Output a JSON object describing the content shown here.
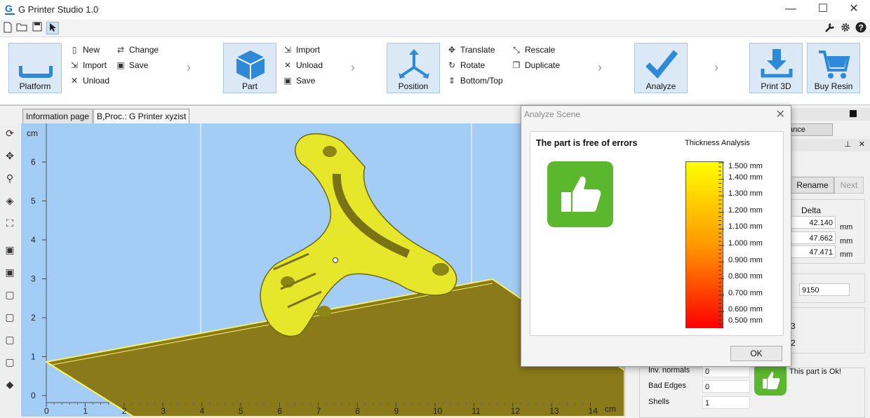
{
  "app": {
    "title": "G Printer Studio 1.0",
    "logo_letter": "G"
  },
  "window_controls": {
    "minimize": "—",
    "maximize": "☐",
    "close": "✕"
  },
  "ribbon": {
    "platform": {
      "label": "Platform",
      "actions": [
        "New",
        "Import",
        "Unload",
        "Change",
        "Save"
      ]
    },
    "part": {
      "label": "Part",
      "actions": [
        "Import",
        "Unload",
        "Save"
      ]
    },
    "position": {
      "label": "Position",
      "actions": [
        "Translate",
        "Rotate",
        "Bottom/Top",
        "Rescale",
        "Duplicate"
      ]
    },
    "analyze": {
      "label": "Analyze"
    },
    "print3d": {
      "label": "Print 3D"
    },
    "buyresin": {
      "label": "Buy Resin"
    }
  },
  "tabs": [
    "Information page",
    "B,Proc.: G Printer xyzist"
  ],
  "viewport": {
    "unit_y": "cm",
    "unit_x": "cm",
    "y_ticks": [
      "6",
      "5",
      "4",
      "3",
      "2",
      "1",
      "0"
    ],
    "x_ticks": [
      "0",
      "1",
      "2",
      "3",
      "4",
      "5",
      "6",
      "7",
      "8",
      "9",
      "10",
      "11",
      "12",
      "13",
      "14"
    ],
    "colors": {
      "background": "#a3cdf5",
      "part": "#e6e62a",
      "platform": "#8a7a1a"
    }
  },
  "dialog": {
    "title": "Analyze Scene",
    "result": "The part is free of errors",
    "thickness_title": "Thickness Analysis",
    "scale_labels": [
      "1.500 mm",
      "1.400 mm",
      "1.300 mm",
      "1.200 mm",
      "1.100 mm",
      "1.000 mm",
      "0.900 mm",
      "0.800 mm",
      "0.700 mm",
      "0.600 mm",
      "0.500 mm"
    ],
    "ok_label": "OK",
    "icon": "thumbs-up-icon",
    "icon_color": "#5bb82e"
  },
  "right_panel": {
    "tab_partial": "ance",
    "rename_label": "Rename",
    "next_label": "Next",
    "delta_header": "Delta",
    "delta_values": [
      "42.140",
      "47.662",
      "47.471"
    ],
    "unit": "mm",
    "count_value": "9150",
    "partial_values": [
      "3",
      "2"
    ],
    "inv_normals_label": "Inv. normals",
    "inv_normals_value": "0",
    "bad_edges_label": "Bad Edges",
    "bad_edges_value": "0",
    "shells_label": "Shells",
    "shells_value": "1",
    "status_text": "This part is Ok!"
  }
}
